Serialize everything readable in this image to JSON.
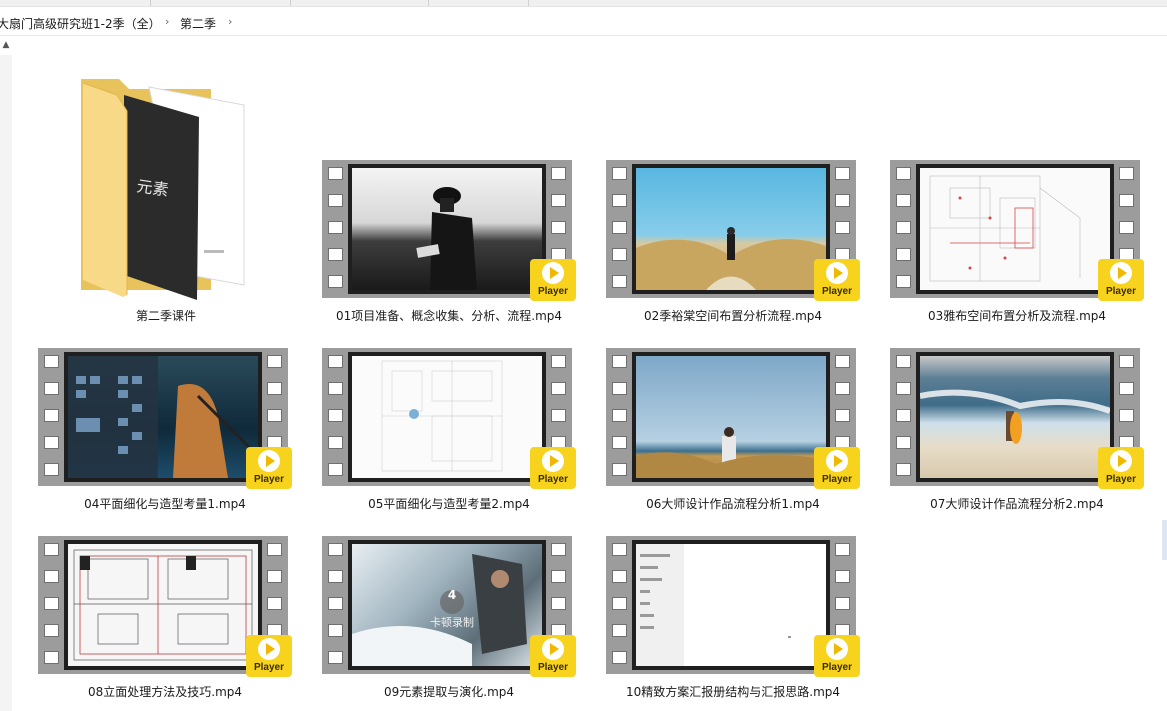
{
  "breadcrumb": [
    {
      "label": "大扇门高级研究班1-2季（全）"
    },
    {
      "label": "第二季"
    }
  ],
  "folder": {
    "name": "第二季课件",
    "cover_text": "元素",
    "icon": "folder-icon"
  },
  "player_badge_label": "Player",
  "files": [
    {
      "name": "01项目准备、概念收集、分析、流程.mp4"
    },
    {
      "name": "02季裕棠空间布置分析流程.mp4"
    },
    {
      "name": "03雅布空间布置分析及流程.mp4"
    },
    {
      "name": "04平面细化与造型考量1.mp4"
    },
    {
      "name": "05平面细化与造型考量2.mp4"
    },
    {
      "name": "06大师设计作品流程分析1.mp4"
    },
    {
      "name": "07大师设计作品流程分析2.mp4"
    },
    {
      "name": "08立面处理方法及技巧.mp4"
    },
    {
      "name": "09元素提取与演化.mp4",
      "overlay_number": "4",
      "overlay_text": "卡顿录制"
    },
    {
      "name": "10精致方案汇报册结构与汇报思路.mp4"
    }
  ],
  "colors": {
    "badge": "#f7d31e",
    "film": "#9c9c9c",
    "folder": "#f5d57a"
  }
}
